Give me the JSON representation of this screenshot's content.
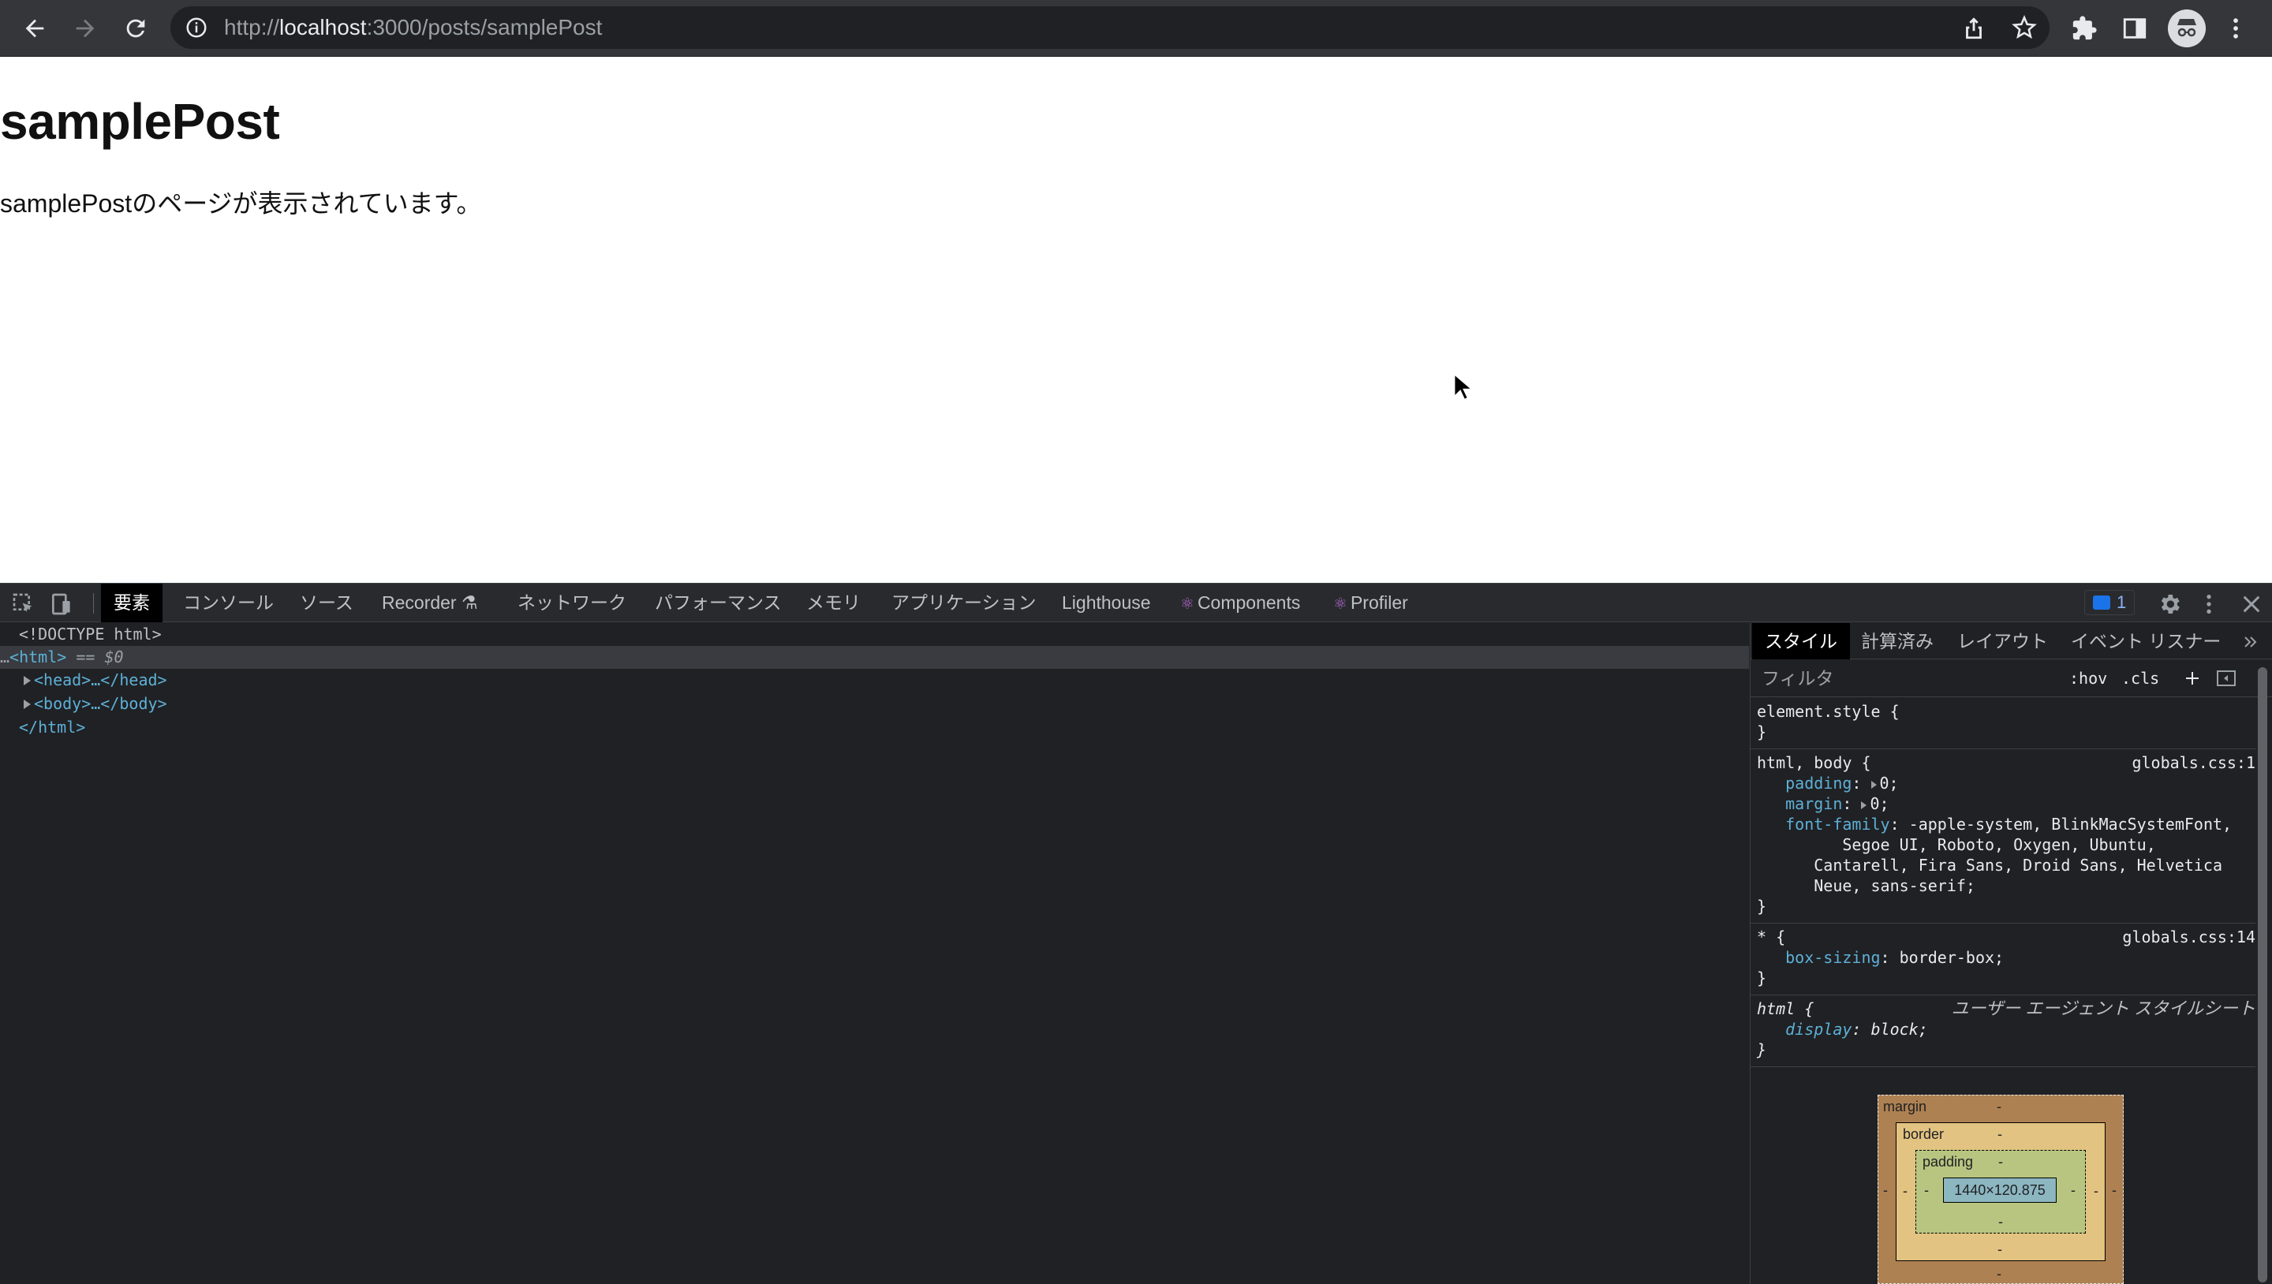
{
  "browser": {
    "url_prefix": "http://",
    "url_host": "localhost",
    "url_rest": ":3000/posts/samplePost"
  },
  "page": {
    "heading": "samplePost",
    "paragraph": "samplePostのページが表示されています。"
  },
  "devtools": {
    "tabs": [
      "要素",
      "コンソール",
      "ソース",
      "Recorder ⚗",
      "ネットワーク",
      "パフォーマンス",
      "メモリ",
      "アプリケーション",
      "Lighthouse",
      "Components",
      "Profiler"
    ],
    "issues_count": "1",
    "dom": {
      "doctype": "<!DOCTYPE html>",
      "html_open": "<html>",
      "selected_marker": "== $0",
      "head": "<head>…</head>",
      "body": "<body>…</body>",
      "html_close": "</html>"
    },
    "styles": {
      "tabs": [
        "スタイル",
        "計算済み",
        "レイアウト",
        "イベント リスナー"
      ],
      "filter_placeholder": "フィルタ",
      "hov": ":hov",
      "cls": ".cls",
      "rules": {
        "r1_selector": "element.style {",
        "r1_close": "}",
        "r2_selector": "html, body {",
        "r2_source": "globals.css:1",
        "r2_p1_name": "padding",
        "r2_p1_val": "0;",
        "r2_p2_name": "margin",
        "r2_p2_val": "0;",
        "r2_p3_name": "font-family",
        "r2_p3_val1": "-apple-system, BlinkMacSystemFont,",
        "r2_p3_val2": "Segoe UI, Roboto, Oxygen, Ubuntu,",
        "r2_p3_val3": "Cantarell, Fira Sans, Droid Sans, Helvetica",
        "r2_p3_val4": "Neue, sans-serif;",
        "r2_close": "}",
        "r3_selector": "* {",
        "r3_source": "globals.css:14",
        "r3_p1_name": "box-sizing",
        "r3_p1_val": "border-box;",
        "r3_close": "}",
        "r4_selector": "html {",
        "r4_source": "ユーザー エージェント スタイルシート",
        "r4_p1_name": "display",
        "r4_p1_val": "block;",
        "r4_close": "}"
      }
    },
    "box_model": {
      "margin_label": "margin",
      "border_label": "border",
      "padding_label": "padding",
      "content_size": "1440×120.875",
      "dash": "-"
    }
  }
}
